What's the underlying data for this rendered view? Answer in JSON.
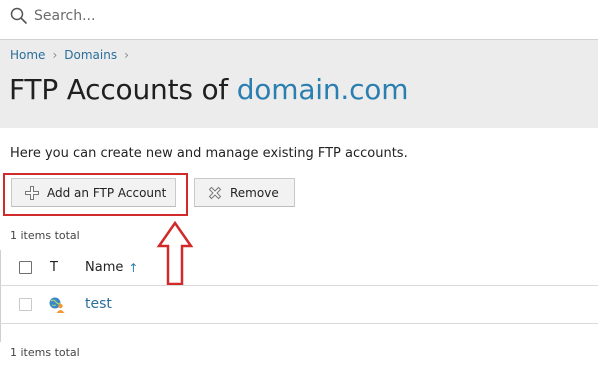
{
  "search": {
    "placeholder": "Search..."
  },
  "breadcrumb": {
    "items": [
      "Home",
      "Domains"
    ]
  },
  "header": {
    "title_prefix": "FTP Accounts of ",
    "title_domain": "domain.com"
  },
  "intro": "Here you can create new and manage existing FTP accounts.",
  "toolbar": {
    "add_label": "Add an FTP Account",
    "remove_label": "Remove"
  },
  "items_total_top": "1 items total",
  "items_total_bottom": "1 items total",
  "table": {
    "columns": {
      "type": "T",
      "name": "Name",
      "sort_indicator": "↑"
    },
    "rows": [
      {
        "name": "test"
      }
    ]
  },
  "colors": {
    "link": "#2a6f9b",
    "accent": "#2a7fb0",
    "highlight": "#d12a2a",
    "header_bg": "#ececec"
  }
}
